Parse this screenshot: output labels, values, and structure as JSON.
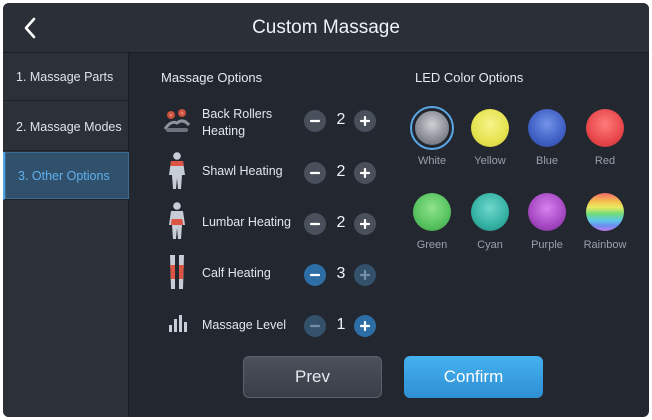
{
  "header": {
    "title": "Custom Massage"
  },
  "sidebar": {
    "items": [
      {
        "label": "1. Massage Parts"
      },
      {
        "label": "2. Massage Modes"
      },
      {
        "label": "3. Other Options"
      }
    ],
    "active": 2
  },
  "massage_options": {
    "title": "Massage Options",
    "items": [
      {
        "label": "Back Rollers Heating",
        "value": "2",
        "icon": "back-rollers-icon"
      },
      {
        "label": "Shawl Heating",
        "value": "2",
        "icon": "shawl-body-icon"
      },
      {
        "label": "Lumbar Heating",
        "value": "2",
        "icon": "lumbar-body-icon"
      },
      {
        "label": "Calf Heating",
        "value": "3",
        "icon": "calf-legs-icon"
      },
      {
        "label": "Massage Level",
        "value": "1",
        "icon": "level-bars-icon"
      }
    ]
  },
  "led_options": {
    "title": "LED Color Options",
    "selected": "White",
    "colors": [
      {
        "label": "White",
        "color": "#9a9ca3"
      },
      {
        "label": "Yellow",
        "color": "#e5e24f"
      },
      {
        "label": "Blue",
        "color": "#3f5fc4"
      },
      {
        "label": "Red",
        "color": "#e8474b"
      },
      {
        "label": "Green",
        "color": "#56c25e"
      },
      {
        "label": "Cyan",
        "color": "#33b1a3"
      },
      {
        "label": "Purple",
        "color": "#a547c2"
      },
      {
        "label": "Rainbow",
        "color": "rainbow"
      }
    ]
  },
  "buttons": {
    "prev": "Prev",
    "confirm": "Confirm"
  },
  "colors": {
    "accent": "#4ea5e6",
    "background": "#23272f",
    "confirm": "#3aa2e3"
  }
}
